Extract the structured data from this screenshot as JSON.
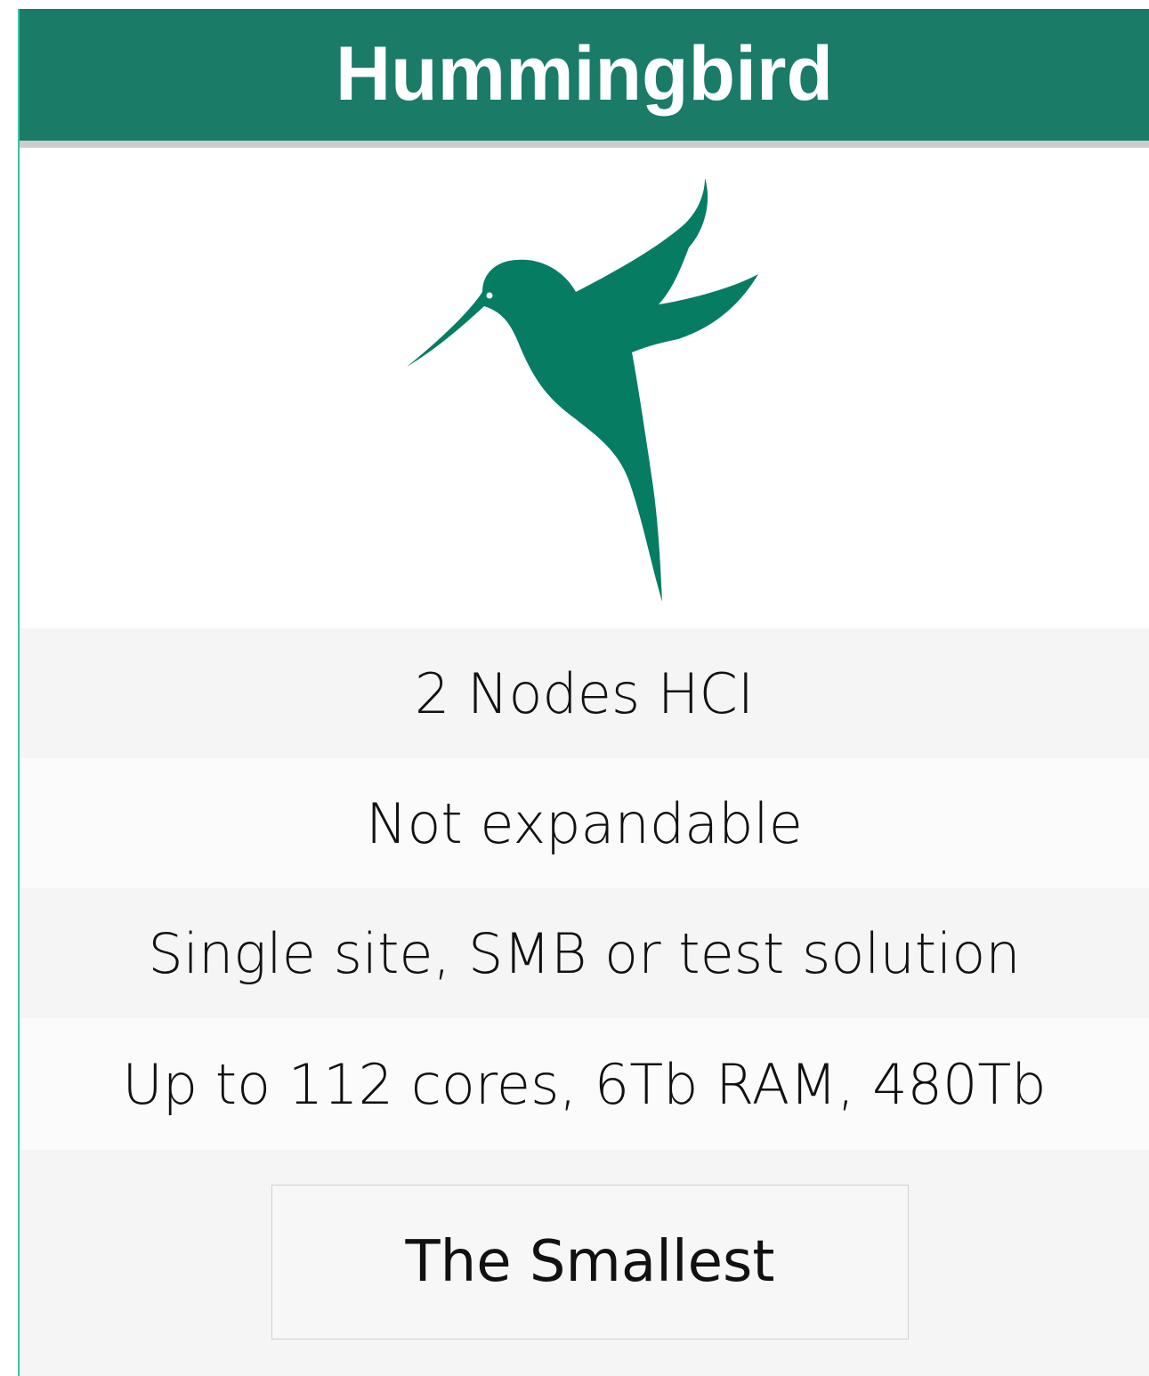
{
  "card": {
    "title": "Hummingbird",
    "logo_icon": "hummingbird-icon",
    "features": [
      "2 Nodes HCI",
      "Not expandable",
      "Single site, SMB or test solution",
      "Up to 112 cores, 6Tb RAM, 480Tb"
    ],
    "cta_label": "The Smallest"
  },
  "colors": {
    "header_bg": "#1a7b67",
    "logo": "#067c63",
    "accent_border": "#3fbfa6"
  }
}
